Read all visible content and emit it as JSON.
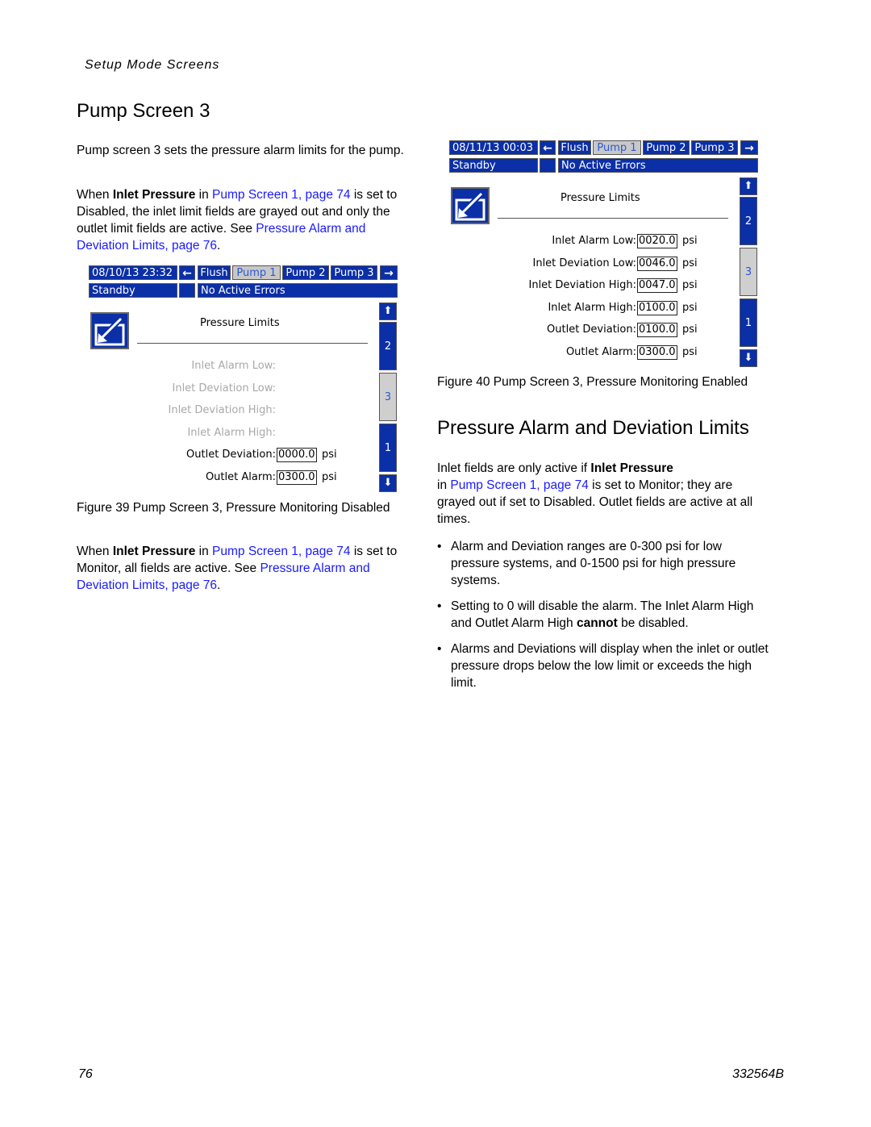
{
  "header": {
    "section": "Setup Mode Screens"
  },
  "section1": {
    "title": "Pump Screen 3",
    "intro": "Pump screen 3 sets the pressure alarm limits for the pump.",
    "para1": {
      "pre": "When ",
      "bold": "Inlet Pressure",
      "mid": " in ",
      "link1": "Pump Screen 1, page 74",
      "post": " is set to Disabled, the inlet limit fields are grayed out and only the outlet limit fields are active.  See ",
      "link2": "Pressure Alarm and Deviation Limits, page 76",
      "end": "."
    },
    "para2": {
      "pre": "When ",
      "bold": "Inlet Pressure",
      "mid": " in ",
      "link1": "Pump Screen 1, page 74",
      "post": " is set to Monitor, all fields are active.  See ",
      "link2": "Pressure Alarm and Deviation Limits, page 76",
      "end": "."
    }
  },
  "figure39": {
    "caption": "Figure 39  Pump Screen 3, Pressure Monitoring Disabled",
    "screen": {
      "datetime": "08/10/13 23:32",
      "tabs": [
        "Flush",
        "Pump 1",
        "Pump 2",
        "Pump 3"
      ],
      "active_tab": "Pump 1",
      "status": "Standby",
      "errors": "No Active Errors",
      "title": "Pressure Limits",
      "fields": [
        {
          "label": "Inlet Alarm Low:",
          "value": "",
          "unit": "",
          "enabled": false
        },
        {
          "label": "Inlet Deviation Low:",
          "value": "",
          "unit": "",
          "enabled": false
        },
        {
          "label": "Inlet Deviation High:",
          "value": "",
          "unit": "",
          "enabled": false
        },
        {
          "label": "Inlet Alarm High:",
          "value": "",
          "unit": "",
          "enabled": false
        },
        {
          "label": "Outlet Deviation:",
          "value": "0000.0",
          "unit": "psi",
          "enabled": true
        },
        {
          "label": "Outlet Alarm:",
          "value": "0300.0",
          "unit": "psi",
          "enabled": true
        }
      ],
      "scroll": {
        "up": "⬆",
        "items": [
          "2",
          "3",
          "1"
        ],
        "active": "3",
        "down": "⬇"
      }
    }
  },
  "figure40": {
    "caption": "Figure 40  Pump Screen 3, Pressure Monitoring Enabled",
    "screen": {
      "datetime": "08/11/13 00:03",
      "tabs": [
        "Flush",
        "Pump 1",
        "Pump 2",
        "Pump 3"
      ],
      "active_tab": "Pump 1",
      "status": "Standby",
      "errors": "No Active Errors",
      "title": "Pressure Limits",
      "fields": [
        {
          "label": "Inlet Alarm Low:",
          "value": "0020.0",
          "unit": "psi",
          "enabled": true
        },
        {
          "label": "Inlet Deviation Low:",
          "value": "0046.0",
          "unit": "psi",
          "enabled": true
        },
        {
          "label": "Inlet Deviation High:",
          "value": "0047.0",
          "unit": "psi",
          "enabled": true
        },
        {
          "label": "Inlet Alarm High:",
          "value": "0100.0",
          "unit": "psi",
          "enabled": true
        },
        {
          "label": "Outlet Deviation:",
          "value": "0100.0",
          "unit": "psi",
          "enabled": true
        },
        {
          "label": "Outlet Alarm:",
          "value": "0300.0",
          "unit": "psi",
          "enabled": true
        }
      ],
      "scroll": {
        "up": "⬆",
        "items": [
          "2",
          "3",
          "1"
        ],
        "active": "3",
        "down": "⬇"
      }
    }
  },
  "section2": {
    "title": "Pressure Alarm and Deviation Limits",
    "intro": {
      "pre": "Inlet fields are only active if ",
      "bold": "Inlet Pressure",
      "mid": " in ",
      "link": "Pump Screen 1, page 74",
      "post": " is set to Monitor; they are grayed out if set to Disabled. Outlet fields are active at all times."
    },
    "bullets": [
      {
        "text": "Alarm and Deviation ranges are 0-300 psi for low pressure systems, and 0-1500 psi for high pressure systems."
      },
      {
        "pre": "Setting to 0 will disable the alarm. The Inlet Alarm High and Outlet Alarm High ",
        "bold": "cannot",
        "post": " be disabled."
      },
      {
        "text": "Alarms and Deviations will display when the inlet or outlet pressure drops below the low limit or exceeds the high limit."
      }
    ]
  },
  "footer": {
    "page_number": "76",
    "doc_id": "332564B"
  }
}
